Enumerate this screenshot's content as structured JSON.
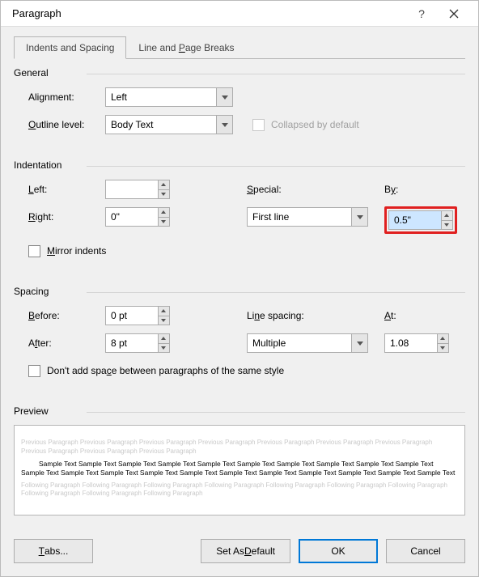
{
  "title": "Paragraph",
  "tabs": {
    "spacing": "Indents and Spacing",
    "breaks": "Line and Page Breaks"
  },
  "sections": {
    "general": "General",
    "indentation": "Indentation",
    "spacing": "Spacing",
    "preview": "Preview"
  },
  "general": {
    "alignment_label": "Alignment:",
    "alignment_value": "Left",
    "outline_label": "Outline level:",
    "outline_value": "Body Text",
    "collapsed_label": "Collapsed by default"
  },
  "indent": {
    "left_label": "Left:",
    "left_value": "",
    "right_label": "Right:",
    "right_value": "0\"",
    "special_label": "Special:",
    "special_value": "First line",
    "by_label": "By:",
    "by_value": "0.5\"",
    "mirror_label": "Mirror indents"
  },
  "spacing": {
    "before_label": "Before:",
    "before_value": "0 pt",
    "after_label": "After:",
    "after_value": "8 pt",
    "line_label": "Line spacing:",
    "line_value": "Multiple",
    "at_label": "At:",
    "at_value": "1.08",
    "nospace_label": "Don't add space between paragraphs of the same style"
  },
  "preview": {
    "prev": "Previous Paragraph Previous Paragraph Previous Paragraph Previous Paragraph Previous Paragraph Previous Paragraph Previous Paragraph Previous Paragraph Previous Paragraph Previous Paragraph",
    "sample": "Sample Text Sample Text Sample Text Sample Text Sample Text Sample Text Sample Text Sample Text Sample Text Sample Text Sample Text Sample Text Sample Text Sample Text Sample Text Sample Text Sample Text Sample Text Sample Text Sample Text Sample Text",
    "next": "Following Paragraph Following Paragraph Following Paragraph Following Paragraph Following Paragraph Following Paragraph Following Paragraph Following Paragraph Following Paragraph Following Paragraph"
  },
  "buttons": {
    "tabs": "Tabs...",
    "default": "Set As Default",
    "ok": "OK",
    "cancel": "Cancel"
  }
}
